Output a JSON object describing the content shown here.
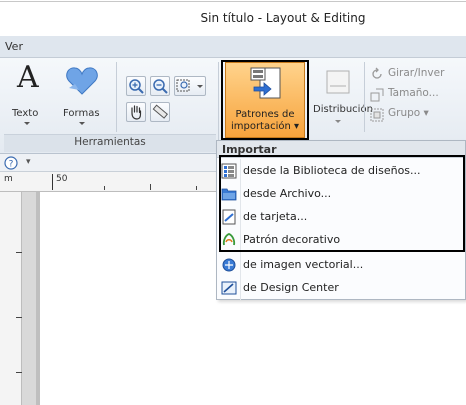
{
  "window": {
    "title": "Sin título - Layout & Editing"
  },
  "menu": {
    "ver": "Ver"
  },
  "ribbon": {
    "texto": "Texto",
    "formas": "Formas",
    "herramientas_group": "Herramientas",
    "import_line1": "Patrones de",
    "import_line2": "importación ▾",
    "distribucion": "Distribución",
    "girar": "Girar/Inver",
    "tamano": "Tamaño...",
    "grupo": "Grupo ▾",
    "font_glyph": "A"
  },
  "ruler": {
    "mark_label": "50",
    "unit": "m"
  },
  "dropdown": {
    "header": "Importar",
    "items": [
      {
        "label": "desde la Biblioteca de diseños...",
        "icon": "library-icon"
      },
      {
        "label": "desde Archivo...",
        "icon": "folder-icon"
      },
      {
        "label": "de tarjeta...",
        "icon": "card-icon"
      },
      {
        "label": "Patrón decorativo",
        "icon": "decorative-pattern-icon"
      },
      {
        "label": "de imagen vectorial...",
        "icon": "vector-image-icon"
      },
      {
        "label": "de Design Center",
        "icon": "design-center-icon"
      }
    ]
  },
  "colors": {
    "import_button_top": "#ffd38c",
    "import_button_bottom": "#f7a33c",
    "ribbon_bg": "#e4eaf1",
    "highlight_border": "#000000"
  }
}
